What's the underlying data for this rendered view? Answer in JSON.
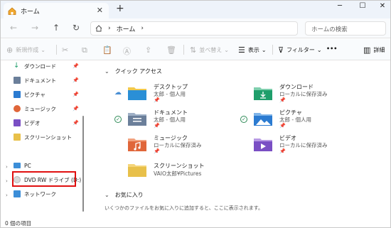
{
  "window": {
    "tab_title": "ホーム",
    "tab_close": "✕",
    "new_tab": "+",
    "minimize": "─",
    "maximize": "☐",
    "close": "✕"
  },
  "nav": {
    "back": "←",
    "forward": "→",
    "up": "↑",
    "refresh": "↻",
    "breadcrumb": [
      "ホーム"
    ],
    "search_placeholder": "ホームの検索"
  },
  "toolbar": {
    "new_label": "新規作成",
    "sort_label": "並べ替え",
    "view_label": "表示",
    "filter_label": "フィルター",
    "more_label": "•••",
    "details_label": "詳細"
  },
  "sidebar": {
    "quick_items": [
      {
        "label": "ダウンロード",
        "color": "#1f9e6b",
        "pinned": true
      },
      {
        "label": "ドキュメント",
        "color": "#6b7f9a",
        "pinned": true
      },
      {
        "label": "ピクチャ",
        "color": "#2b7bd1",
        "pinned": true
      },
      {
        "label": "ミュージック",
        "color": "#e0663a",
        "pinned": true
      },
      {
        "label": "ビデオ",
        "color": "#7a4fc4",
        "pinned": true
      },
      {
        "label": "スクリーンショット",
        "color": "#e8c04a",
        "pinned": false
      }
    ],
    "pc_label": "PC",
    "dvd_label": "DVD RW ドライブ (D:)",
    "network_label": "ネットワーク",
    "pin_glyph": "📌"
  },
  "main": {
    "quick_access_title": "クイック アクセス",
    "favorites_title": "お気に入り",
    "favorites_empty": "いくつかのファイルをお気に入りに追加すると、ここに表示されます。",
    "folders": [
      {
        "name": "デスクトップ",
        "sub": "太郎 - 個人用",
        "status": "cloud",
        "color": "#2a8fd6"
      },
      {
        "name": "ダウンロード",
        "sub": "ローカルに保存済み",
        "status": "",
        "color": "#1f9e6b"
      },
      {
        "name": "ドキュメント",
        "sub": "太郎 - 個人用",
        "status": "check",
        "color": "#6b7f9a"
      },
      {
        "name": "ピクチャ",
        "sub": "太郎 - 個人用",
        "status": "check",
        "color": "#2b7bd1"
      },
      {
        "name": "ミュージック",
        "sub": "ローカルに保存済み",
        "status": "",
        "color": "#e0663a"
      },
      {
        "name": "ビデオ",
        "sub": "ローカルに保存済み",
        "status": "",
        "color": "#7a4fc4"
      },
      {
        "name": "スクリーンショット",
        "sub": "VAIO太郎¥Pictures",
        "status": "",
        "color": "#e8c04a"
      }
    ]
  },
  "statusbar": {
    "items_text": "0 個の項目"
  }
}
